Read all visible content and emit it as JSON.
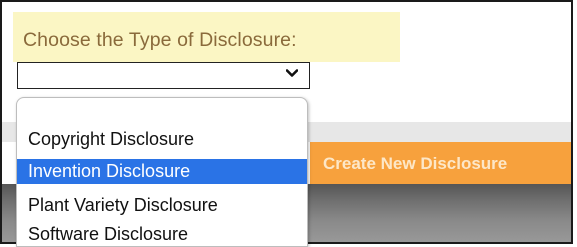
{
  "form": {
    "label": "Choose the Type of Disclosure:",
    "select_value": ""
  },
  "dropdown": {
    "options": [
      {
        "label": "Copyright Disclosure",
        "selected": false
      },
      {
        "label": "Invention Disclosure",
        "selected": true
      },
      {
        "label": "Plant Variety Disclosure",
        "selected": false
      },
      {
        "label": "Software Disclosure",
        "selected": false
      }
    ]
  },
  "actions": {
    "create_label": "Create New Disclosure"
  },
  "colors": {
    "label_bg": "#fbf6c4",
    "label_text": "#8a6a3b",
    "selected_option_bg": "#2a73e6",
    "create_button_bg": "#f7a13d"
  },
  "icons": {
    "select_caret": "chevron-down-icon"
  }
}
